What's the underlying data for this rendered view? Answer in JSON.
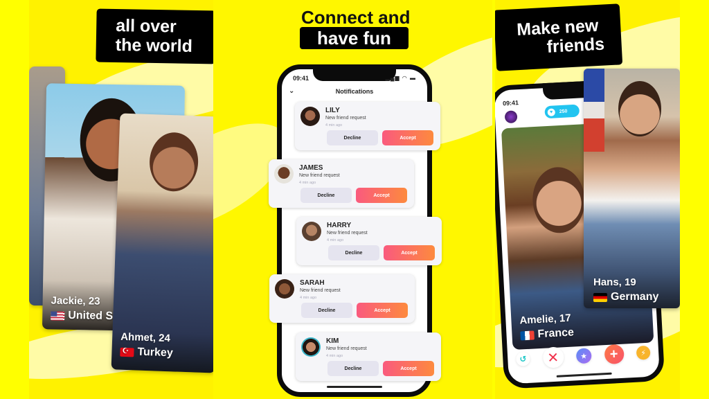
{
  "colors": {
    "background_yellow": "#fff200",
    "accept_gradient_start": "#fa5a7e",
    "accept_gradient_end": "#fd8a3e",
    "decline_bg": "#e5e4ef",
    "coin_badge": "#22c4f0"
  },
  "panel_a": {
    "headline": [
      "all over",
      "the world"
    ],
    "profiles": [
      {
        "name_age": "Jackie, 23",
        "country": "United St",
        "flag": "us-flag-icon"
      },
      {
        "name_age": "Ahmet, 24",
        "country": "Turkey",
        "flag": "turkey-flag-icon"
      }
    ]
  },
  "panel_b": {
    "headline_line1": "Connect and",
    "headline_line2": "have fun",
    "phone": {
      "time": "09:41",
      "status_icons": "▂▄▆ ◠ ▬",
      "back_icon": "⌄",
      "title": "Notifications"
    },
    "notifications": [
      {
        "name": "LILY",
        "message": "New friend request",
        "time": "4 min ago",
        "decline": "Decline",
        "accept": "Accept"
      },
      {
        "name": "JAMES",
        "message": "New friend request",
        "time": "4 min ago",
        "decline": "Decline",
        "accept": "Accept"
      },
      {
        "name": "HARRY",
        "message": "New friend request",
        "time": "4 min ago",
        "decline": "Decline",
        "accept": "Accept"
      },
      {
        "name": "SARAH",
        "message": "New friend request",
        "time": "4 min ago",
        "decline": "Decline",
        "accept": "Accept"
      },
      {
        "name": "KIM",
        "message": "New friend request",
        "time": "4 min ago",
        "decline": "Decline",
        "accept": "Accept"
      }
    ]
  },
  "panel_c": {
    "headline": [
      "Make new",
      "friends"
    ],
    "phone": {
      "time": "09:41",
      "coins": "250",
      "gem_icon": "♥"
    },
    "profiles": [
      {
        "name_age": "Amelie, 17",
        "country": "France",
        "flag": "france-flag-icon"
      },
      {
        "name_age": "Hans, 19",
        "country": "Germany",
        "flag": "germany-flag-icon"
      }
    ],
    "actions": [
      {
        "name": "undo-icon",
        "glyph": "↺"
      },
      {
        "name": "nope-icon",
        "glyph": "✕"
      },
      {
        "name": "super-like-star-icon",
        "glyph": "★"
      },
      {
        "name": "add-friend-plus-icon",
        "glyph": "+"
      },
      {
        "name": "boost-lightning-icon",
        "glyph": "⚡"
      }
    ]
  }
}
